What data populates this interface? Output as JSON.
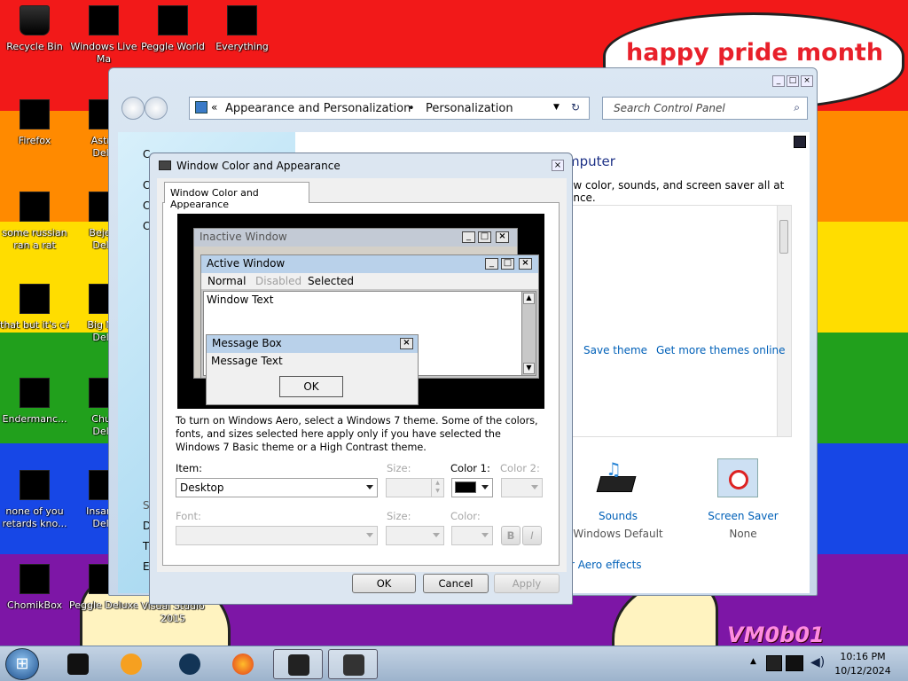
{
  "wallpaper": {
    "stripe_colors": [
      "#f21919",
      "#ff8a00",
      "#ffdd00",
      "#21a01c",
      "#1747e6",
      "#7d16a6"
    ],
    "bubble_text": "happy pride month",
    "signature": "VM0b01"
  },
  "desktop_icons": [
    {
      "label": "Recycle Bin",
      "label2": ""
    },
    {
      "label": "Windows Live",
      "label2": "Ma"
    },
    {
      "label": "Peggle World",
      "label2": ""
    },
    {
      "label": "Everything",
      "label2": ""
    },
    {
      "label": "Firefox",
      "label2": ""
    },
    {
      "label": "Astro",
      "label2": "Delu"
    },
    {
      "label": "some russian",
      "label2": "ran a rat"
    },
    {
      "label": "Bejew",
      "label2": "Delu"
    },
    {
      "label": "that but it's c#",
      "label2": ""
    },
    {
      "label": "Big Mo",
      "label2": "Delu"
    },
    {
      "label": "Endermanc...",
      "label2": ""
    },
    {
      "label": "Chuz",
      "label2": "Delu"
    },
    {
      "label": "none of you",
      "label2": "retards kno..."
    },
    {
      "label": "Insaniq",
      "label2": "Delu"
    },
    {
      "label": "ChomikBox",
      "label2": ""
    },
    {
      "label": "Peggle Deluxe",
      "label2": ""
    },
    {
      "label": "Visual Studio",
      "label2": "2015"
    }
  ],
  "control_panel": {
    "breadcrumb": [
      "Appearance and Personalization",
      "Personalization"
    ],
    "search_placeholder": "Search Control Panel",
    "heading": "mputer",
    "subheading": "ow color, sounds, and screen saver all at once.",
    "save_theme": "Save theme",
    "get_more_themes": "Get more themes online",
    "sounds_label": "Sounds",
    "sounds_value": "Windows Default",
    "screensaver_label": "Screen Saver",
    "screensaver_value": "None",
    "aero_link": "r Aero effects",
    "sidebar_letters": [
      "C",
      "C",
      "C",
      "C",
      "Se",
      "D",
      "T",
      "Ea"
    ]
  },
  "dialog": {
    "title": "Window Color and Appearance",
    "tab": "Window Color and Appearance",
    "preview": {
      "inactive_title": "Inactive Window",
      "active_title": "Active Window",
      "menu_normal": "Normal",
      "menu_disabled": "Disabled",
      "menu_selected": "Selected",
      "window_text": "Window Text",
      "msgbox_title": "Message Box",
      "msgbox_text": "Message Text",
      "ok": "OK"
    },
    "description": "To turn on Windows Aero, select a Windows 7 theme.  Some of the colors, fonts, and sizes selected here apply only if you have selected the Windows 7 Basic theme or a High Contrast theme.",
    "item_label": "Item:",
    "item_value": "Desktop",
    "size_label": "Size:",
    "color1_label": "Color 1:",
    "color1_value": "#000000",
    "color2_label": "Color 2:",
    "font_label": "Font:",
    "font_size_label": "Size:",
    "font_color_label": "Color:",
    "bold_label": "B",
    "italic_label": "I",
    "ok": "OK",
    "cancel": "Cancel",
    "apply": "Apply"
  },
  "taskbar": {
    "time": "10:16 PM",
    "date": "10/12/2024"
  }
}
